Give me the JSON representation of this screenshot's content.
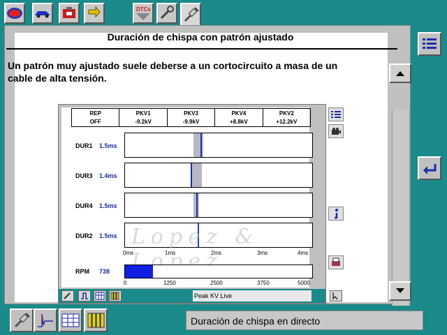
{
  "toolbar": {
    "tabs": [
      {
        "name": "logo-tab",
        "icon": "brand-logo-icon"
      },
      {
        "name": "vehicle-tab",
        "icon": "car-icon"
      },
      {
        "name": "engine-tab",
        "icon": "engine-icon"
      },
      {
        "name": "wiring-tab",
        "icon": "connector-icon"
      },
      {
        "name": "dtc-tab",
        "icon": "dtc-icon",
        "label": "DTCs"
      },
      {
        "name": "tools-tab",
        "icon": "wrench-icon"
      },
      {
        "name": "ignition-tab",
        "icon": "spark-plug-icon"
      }
    ]
  },
  "document": {
    "title": "Duración de chispa con patrón ajustado",
    "body": "Un patrón muy ajustado suele deberse a un cortocircuito a masa de un cable de alta tensión."
  },
  "scope": {
    "headers": [
      {
        "top": "REP",
        "bottom": "OFF"
      },
      {
        "top": "PKV1",
        "bottom": "-9.2kV"
      },
      {
        "top": "PKV3",
        "bottom": "-9.9kV"
      },
      {
        "top": "PKV4",
        "bottom": "+8.8kV"
      },
      {
        "top": "PKV2",
        "bottom": "+12.2kV"
      }
    ],
    "channels": [
      {
        "label": "DUR1",
        "value": "1.5ms",
        "duration_ms": 1.5
      },
      {
        "label": "DUR3",
        "value": "1.4ms",
        "duration_ms": 1.4
      },
      {
        "label": "DUR4",
        "value": "1.5ms",
        "duration_ms": 1.5
      },
      {
        "label": "DUR2",
        "value": "1.5ms",
        "duration_ms": 1.5
      }
    ],
    "time_ticks": [
      "0ms",
      "1ms",
      "2ms",
      "3ms",
      "4ms"
    ],
    "rpm_label": "RPM",
    "rpm_value": "738",
    "rpm": 738,
    "rpm_max": 5000,
    "rpm_ticks": [
      "0",
      "1250",
      "2500",
      "3750",
      "5000"
    ],
    "watermark": "Lopez & Lopez",
    "live_label": "Peak KV Live"
  },
  "status": {
    "text": "Duración de chispa en directo"
  },
  "colors": {
    "background": "#1a8a8a",
    "accent_blue": "#1a2daa",
    "rpm_fill": "#1020e0"
  }
}
